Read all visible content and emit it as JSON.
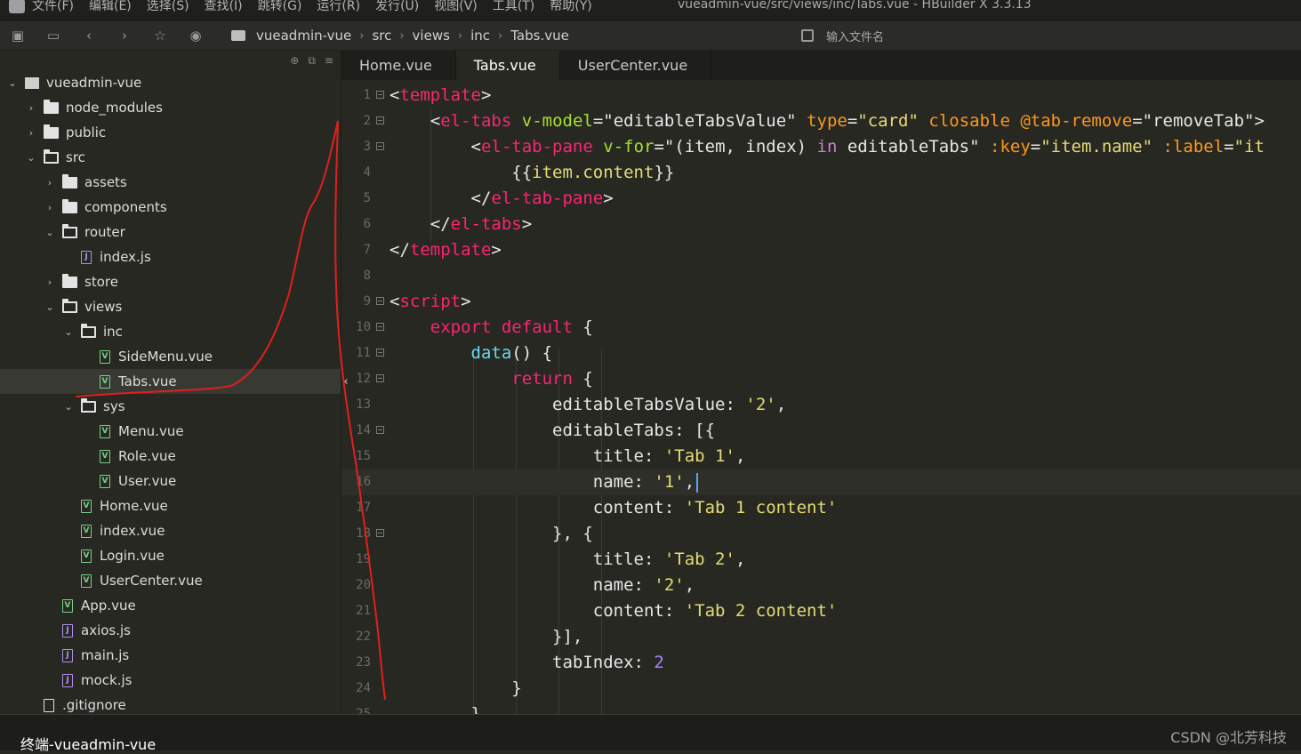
{
  "menubar": {
    "items": [
      "文件(F)",
      "编辑(E)",
      "选择(S)",
      "查找(I)",
      "跳转(G)",
      "运行(R)",
      "发行(U)",
      "视图(V)",
      "工具(T)",
      "帮助(Y)"
    ],
    "window_title": "vueadmin-vue/src/views/inc/Tabs.vue - HBuilder X 3.3.13"
  },
  "toolbar": {
    "breadcrumb": [
      "vueadmin-vue",
      "src",
      "views",
      "inc",
      "Tabs.vue"
    ],
    "search_placeholder": "输入文件名"
  },
  "sidebar": {
    "tree": [
      {
        "label": "vueadmin-vue",
        "depth": 0,
        "kind": "project",
        "expanded": true
      },
      {
        "label": "node_modules",
        "depth": 1,
        "kind": "folder",
        "expanded": false
      },
      {
        "label": "public",
        "depth": 1,
        "kind": "folder",
        "expanded": false
      },
      {
        "label": "src",
        "depth": 1,
        "kind": "folder",
        "expanded": true
      },
      {
        "label": "assets",
        "depth": 2,
        "kind": "folder",
        "expanded": false
      },
      {
        "label": "components",
        "depth": 2,
        "kind": "folder",
        "expanded": false
      },
      {
        "label": "router",
        "depth": 2,
        "kind": "folder",
        "expanded": true
      },
      {
        "label": "index.js",
        "depth": 3,
        "kind": "js"
      },
      {
        "label": "store",
        "depth": 2,
        "kind": "folder",
        "expanded": false
      },
      {
        "label": "views",
        "depth": 2,
        "kind": "folder",
        "expanded": true
      },
      {
        "label": "inc",
        "depth": 3,
        "kind": "folder",
        "expanded": true
      },
      {
        "label": "SideMenu.vue",
        "depth": 4,
        "kind": "vue"
      },
      {
        "label": "Tabs.vue",
        "depth": 4,
        "kind": "vue",
        "selected": true
      },
      {
        "label": "sys",
        "depth": 3,
        "kind": "folder",
        "expanded": true
      },
      {
        "label": "Menu.vue",
        "depth": 4,
        "kind": "vue"
      },
      {
        "label": "Role.vue",
        "depth": 4,
        "kind": "vue"
      },
      {
        "label": "User.vue",
        "depth": 4,
        "kind": "vue"
      },
      {
        "label": "Home.vue",
        "depth": 3,
        "kind": "vue"
      },
      {
        "label": "index.vue",
        "depth": 3,
        "kind": "vue"
      },
      {
        "label": "Login.vue",
        "depth": 3,
        "kind": "vue"
      },
      {
        "label": "UserCenter.vue",
        "depth": 3,
        "kind": "vue"
      },
      {
        "label": "App.vue",
        "depth": 2,
        "kind": "vue"
      },
      {
        "label": "axios.js",
        "depth": 2,
        "kind": "js"
      },
      {
        "label": "main.js",
        "depth": 2,
        "kind": "js"
      },
      {
        "label": "mock.js",
        "depth": 2,
        "kind": "js"
      },
      {
        "label": ".gitignore",
        "depth": 1,
        "kind": "plain"
      }
    ]
  },
  "editor_tabs": [
    {
      "label": "Home.vue",
      "active": false
    },
    {
      "label": "Tabs.vue",
      "active": true
    },
    {
      "label": "UserCenter.vue",
      "active": false
    }
  ],
  "code": {
    "lines": [
      {
        "n": "1",
        "fold": true,
        "tokens": [
          [
            "t-punc",
            "<"
          ],
          [
            "t-tag",
            "template"
          ],
          [
            "t-punc",
            ">"
          ]
        ]
      },
      {
        "n": "2",
        "fold": true,
        "tokens": [
          [
            "t-plain",
            "    "
          ],
          [
            "t-punc",
            "<"
          ],
          [
            "t-tag",
            "el-tabs"
          ],
          [
            "t-plain",
            " "
          ],
          [
            "t-attr",
            "v-model"
          ],
          [
            "t-punc",
            "="
          ],
          [
            "t-plain",
            "\"editableTabsValue\""
          ],
          [
            "t-plain",
            " "
          ],
          [
            "t-orange",
            "type"
          ],
          [
            "t-punc",
            "="
          ],
          [
            "t-str",
            "\"card\""
          ],
          [
            "t-plain",
            " "
          ],
          [
            "t-orange",
            "closable"
          ],
          [
            "t-plain",
            " "
          ],
          [
            "t-orange",
            "@tab-remove"
          ],
          [
            "t-punc",
            "="
          ],
          [
            "t-plain",
            "\"removeTab\">"
          ]
        ]
      },
      {
        "n": "3",
        "fold": true,
        "tokens": [
          [
            "t-plain",
            "        "
          ],
          [
            "t-punc",
            "<"
          ],
          [
            "t-tag",
            "el-tab-pane"
          ],
          [
            "t-plain",
            " "
          ],
          [
            "t-attr",
            "v-for"
          ],
          [
            "t-punc",
            "="
          ],
          [
            "t-plain",
            "\"(item, index) "
          ],
          [
            "t-pv",
            "in"
          ],
          [
            "t-plain",
            " editableTabs\""
          ],
          [
            "t-plain",
            " "
          ],
          [
            "t-orange",
            ":key"
          ],
          [
            "t-punc",
            "="
          ],
          [
            "t-str",
            "\"item.name\""
          ],
          [
            "t-plain",
            " "
          ],
          [
            "t-orange",
            ":label"
          ],
          [
            "t-punc",
            "="
          ],
          [
            "t-str",
            "\"it"
          ]
        ]
      },
      {
        "n": "4",
        "fold": false,
        "tokens": [
          [
            "t-plain",
            "            {{"
          ],
          [
            "t-str",
            "item.content"
          ],
          [
            "t-plain",
            "}}"
          ]
        ]
      },
      {
        "n": "5",
        "fold": false,
        "tokens": [
          [
            "t-plain",
            "        "
          ],
          [
            "t-punc",
            "</"
          ],
          [
            "t-tag",
            "el-tab-pane"
          ],
          [
            "t-punc",
            ">"
          ]
        ]
      },
      {
        "n": "6",
        "fold": false,
        "tokens": [
          [
            "t-plain",
            "    "
          ],
          [
            "t-punc",
            "</"
          ],
          [
            "t-tag",
            "el-tabs"
          ],
          [
            "t-punc",
            ">"
          ]
        ]
      },
      {
        "n": "7",
        "fold": false,
        "tokens": [
          [
            "t-punc",
            "</"
          ],
          [
            "t-tag",
            "template"
          ],
          [
            "t-punc",
            ">"
          ]
        ]
      },
      {
        "n": "8",
        "fold": false,
        "tokens": []
      },
      {
        "n": "9",
        "fold": true,
        "tokens": [
          [
            "t-punc",
            "<"
          ],
          [
            "t-tag",
            "script"
          ],
          [
            "t-punc",
            ">"
          ]
        ]
      },
      {
        "n": "10",
        "fold": true,
        "tokens": [
          [
            "t-plain",
            "    "
          ],
          [
            "t-kw",
            "export"
          ],
          [
            "t-plain",
            " "
          ],
          [
            "t-kw",
            "default"
          ],
          [
            "t-plain",
            " {"
          ]
        ]
      },
      {
        "n": "11",
        "fold": true,
        "tokens": [
          [
            "t-plain",
            "        "
          ],
          [
            "t-fn",
            "data"
          ],
          [
            "t-plain",
            "() {"
          ]
        ]
      },
      {
        "n": "12",
        "fold": true,
        "tokens": [
          [
            "t-plain",
            "            "
          ],
          [
            "t-kw",
            "return"
          ],
          [
            "t-plain",
            " {"
          ]
        ]
      },
      {
        "n": "13",
        "fold": false,
        "tokens": [
          [
            "t-plain",
            "                editableTabsValue: "
          ],
          [
            "t-str",
            "'2'"
          ],
          [
            "t-plain",
            ","
          ]
        ]
      },
      {
        "n": "14",
        "fold": true,
        "tokens": [
          [
            "t-plain",
            "                editableTabs: [{"
          ]
        ]
      },
      {
        "n": "15",
        "fold": false,
        "tokens": [
          [
            "t-plain",
            "                    title: "
          ],
          [
            "t-str",
            "'Tab 1'"
          ],
          [
            "t-plain",
            ","
          ]
        ]
      },
      {
        "n": "16",
        "fold": false,
        "current": true,
        "tokens": [
          [
            "t-plain",
            "                    name: "
          ],
          [
            "t-str",
            "'1'"
          ],
          [
            "t-plain",
            ","
          ]
        ]
      },
      {
        "n": "17",
        "fold": false,
        "tokens": [
          [
            "t-plain",
            "                    content: "
          ],
          [
            "t-str",
            "'Tab 1 content'"
          ]
        ]
      },
      {
        "n": "18",
        "fold": true,
        "tokens": [
          [
            "t-plain",
            "                }, {"
          ]
        ]
      },
      {
        "n": "19",
        "fold": false,
        "tokens": [
          [
            "t-plain",
            "                    title: "
          ],
          [
            "t-str",
            "'Tab 2'"
          ],
          [
            "t-plain",
            ","
          ]
        ]
      },
      {
        "n": "20",
        "fold": false,
        "tokens": [
          [
            "t-plain",
            "                    name: "
          ],
          [
            "t-str",
            "'2'"
          ],
          [
            "t-plain",
            ","
          ]
        ]
      },
      {
        "n": "21",
        "fold": false,
        "tokens": [
          [
            "t-plain",
            "                    content: "
          ],
          [
            "t-str",
            "'Tab 2 content'"
          ]
        ]
      },
      {
        "n": "22",
        "fold": false,
        "tokens": [
          [
            "t-plain",
            "                }],"
          ]
        ]
      },
      {
        "n": "23",
        "fold": false,
        "tokens": [
          [
            "t-plain",
            "                tabIndex: "
          ],
          [
            "t-num",
            "2"
          ]
        ]
      },
      {
        "n": "24",
        "fold": false,
        "tokens": [
          [
            "t-plain",
            "            }"
          ]
        ]
      },
      {
        "n": "25",
        "fold": false,
        "tokens": [
          [
            "t-plain",
            "        },"
          ]
        ]
      }
    ]
  },
  "statusbar": {
    "terminal_label": "终端-vueadmin-vue",
    "watermark": "CSDN @北芳科技"
  },
  "colors": {
    "annotation": "#e0201e",
    "background": "#272822"
  }
}
